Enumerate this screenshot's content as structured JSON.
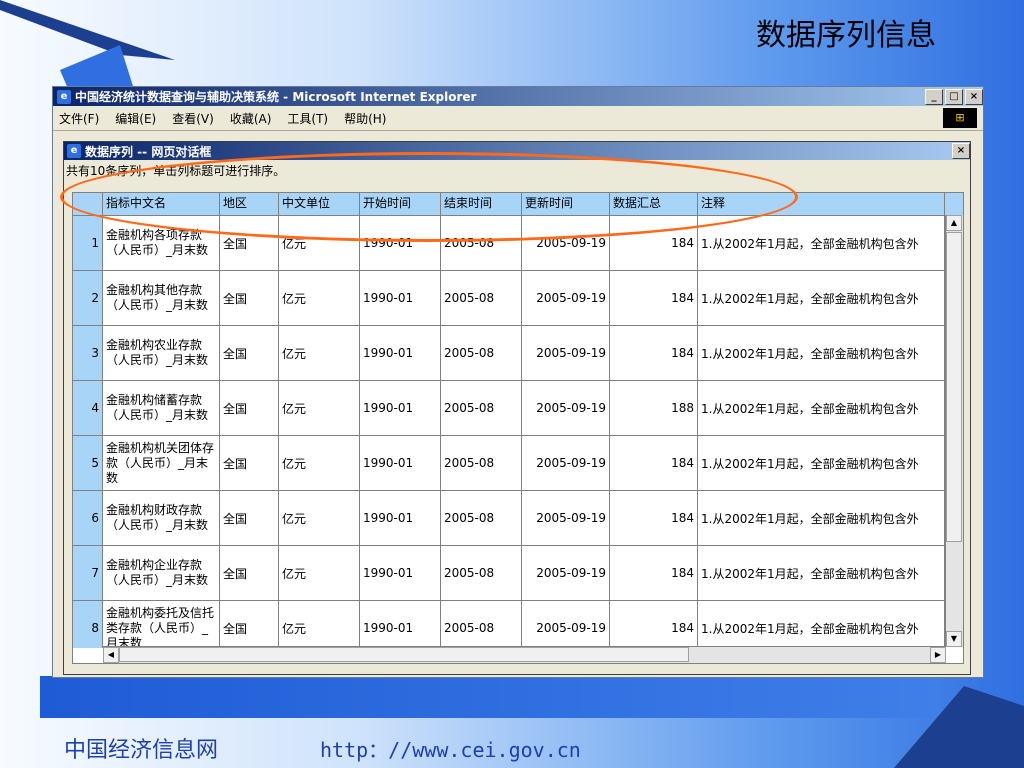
{
  "slide": {
    "title": "数据序列信息",
    "footer_left": "中国经济信息网",
    "footer_url": "http：//www.cei.gov.cn",
    "accent_color": "#ff6a1a"
  },
  "ie": {
    "title": "中国经济统计数据查询与辅助决策系统 - Microsoft Internet Explorer",
    "menu": [
      "文件(F)",
      "编辑(E)",
      "查看(V)",
      "收藏(A)",
      "工具(T)",
      "帮助(H)"
    ],
    "win_buttons": [
      "_",
      "□",
      "×"
    ]
  },
  "dialog": {
    "title": "数据序列 -- 网页对话框",
    "close": "×",
    "info": "共有10条序列，单击列标题可进行排序。",
    "columns": [
      "",
      "指标中文名",
      "地区",
      "中文单位",
      "开始时间",
      "结束时间",
      "更新时间",
      "数据汇总",
      "注释"
    ],
    "rows": [
      [
        "1",
        "金融机构各项存款（人民币）_月末数",
        "全国",
        "亿元",
        "1990-01",
        "2005-08",
        "2005-09-19",
        "184",
        "1.从2002年1月起，全部金融机构包含外"
      ],
      [
        "2",
        "金融机构其他存款（人民币）_月末数",
        "全国",
        "亿元",
        "1990-01",
        "2005-08",
        "2005-09-19",
        "184",
        "1.从2002年1月起，全部金融机构包含外"
      ],
      [
        "3",
        "金融机构农业存款（人民币）_月末数",
        "全国",
        "亿元",
        "1990-01",
        "2005-08",
        "2005-09-19",
        "184",
        "1.从2002年1月起，全部金融机构包含外"
      ],
      [
        "4",
        "金融机构储蓄存款（人民币）_月末数",
        "全国",
        "亿元",
        "1990-01",
        "2005-08",
        "2005-09-19",
        "188",
        "1.从2002年1月起，全部金融机构包含外"
      ],
      [
        "5",
        "金融机构机关团体存款（人民币）_月末数",
        "全国",
        "亿元",
        "1990-01",
        "2005-08",
        "2005-09-19",
        "184",
        "1.从2002年1月起，全部金融机构包含外"
      ],
      [
        "6",
        "金融机构财政存款（人民币）_月末数",
        "全国",
        "亿元",
        "1990-01",
        "2005-08",
        "2005-09-19",
        "184",
        "1.从2002年1月起，全部金融机构包含外"
      ],
      [
        "7",
        "金融机构企业存款（人民币）_月末数",
        "全国",
        "亿元",
        "1990-01",
        "2005-08",
        "2005-09-19",
        "184",
        "1.从2002年1月起，全部金融机构包含外"
      ],
      [
        "8",
        "金融机构委托及信托类存款（人民币）_月末数",
        "全国",
        "亿元",
        "1990-01",
        "2005-08",
        "2005-09-19",
        "184",
        "1.从2002年1月起，全部金融机构包含外"
      ]
    ]
  }
}
